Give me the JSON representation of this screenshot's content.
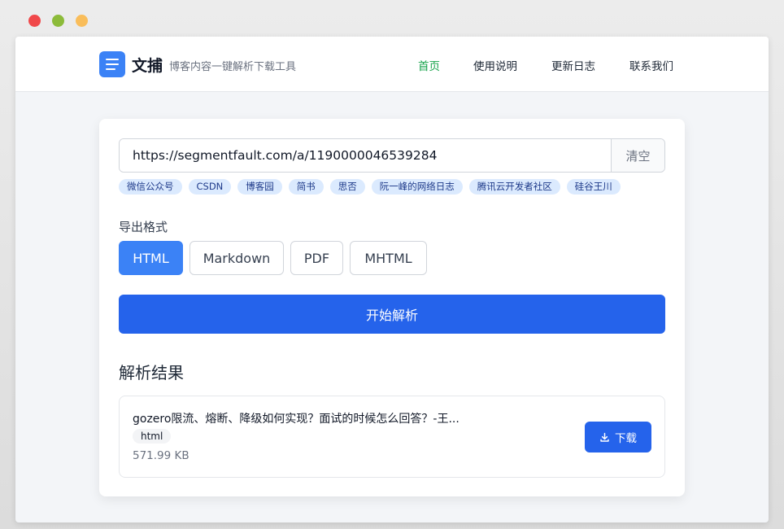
{
  "brand": {
    "name": "文捕",
    "tagline": "博客内容一键解析下载工具"
  },
  "nav": {
    "items": [
      {
        "label": "首页",
        "active": true
      },
      {
        "label": "使用说明",
        "active": false
      },
      {
        "label": "更新日志",
        "active": false
      },
      {
        "label": "联系我们",
        "active": false
      }
    ]
  },
  "url_input": {
    "value": "https://segmentfault.com/a/1190000046539284",
    "clear_label": "清空"
  },
  "sources": [
    "微信公众号",
    "CSDN",
    "博客园",
    "简书",
    "思否",
    "阮一峰的网络日志",
    "腾讯云开发者社区",
    "硅谷王川"
  ],
  "export": {
    "label": "导出格式",
    "formats": [
      "HTML",
      "Markdown",
      "PDF",
      "MHTML"
    ],
    "selected": "HTML"
  },
  "start_label": "开始解析",
  "results": {
    "title": "解析结果",
    "items": [
      {
        "name": "gozero限流、熔断、降级如何实现？面试的时候怎么回答？-王...",
        "format": "html",
        "size": "571.99 KB",
        "download_label": "下载"
      }
    ]
  },
  "colors": {
    "primary": "#2563eb",
    "accent": "#3b82f6",
    "nav_active": "#16a34a",
    "chip_bg": "#dbeafe"
  }
}
